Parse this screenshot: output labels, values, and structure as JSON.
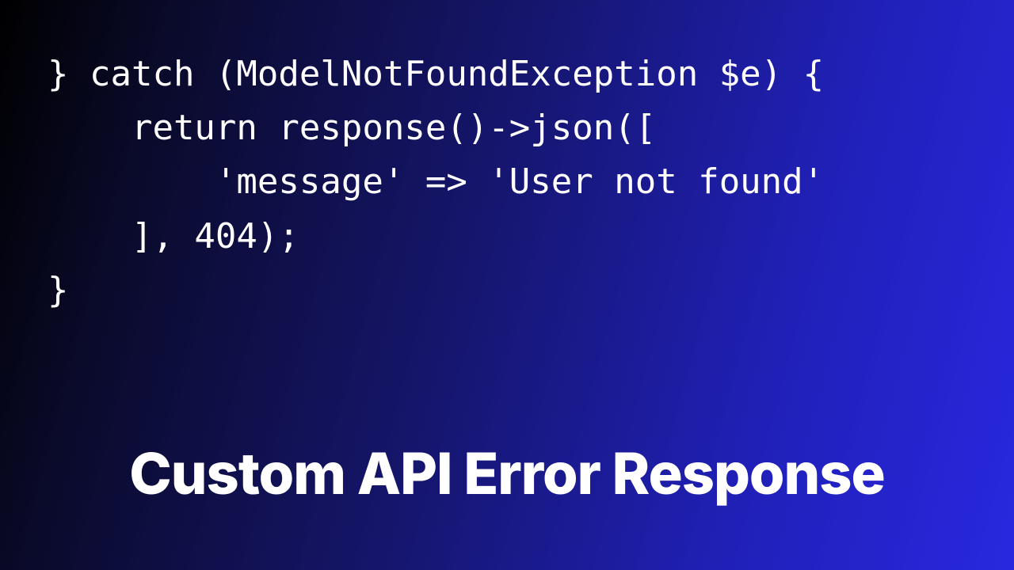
{
  "code": {
    "line1": "} catch (ModelNotFoundException $e) {",
    "line2": "    return response()->json([",
    "line3": "        'message' => 'User not found'",
    "line4": "    ], 404);",
    "line5": "}"
  },
  "title": "Custom API Error Response"
}
